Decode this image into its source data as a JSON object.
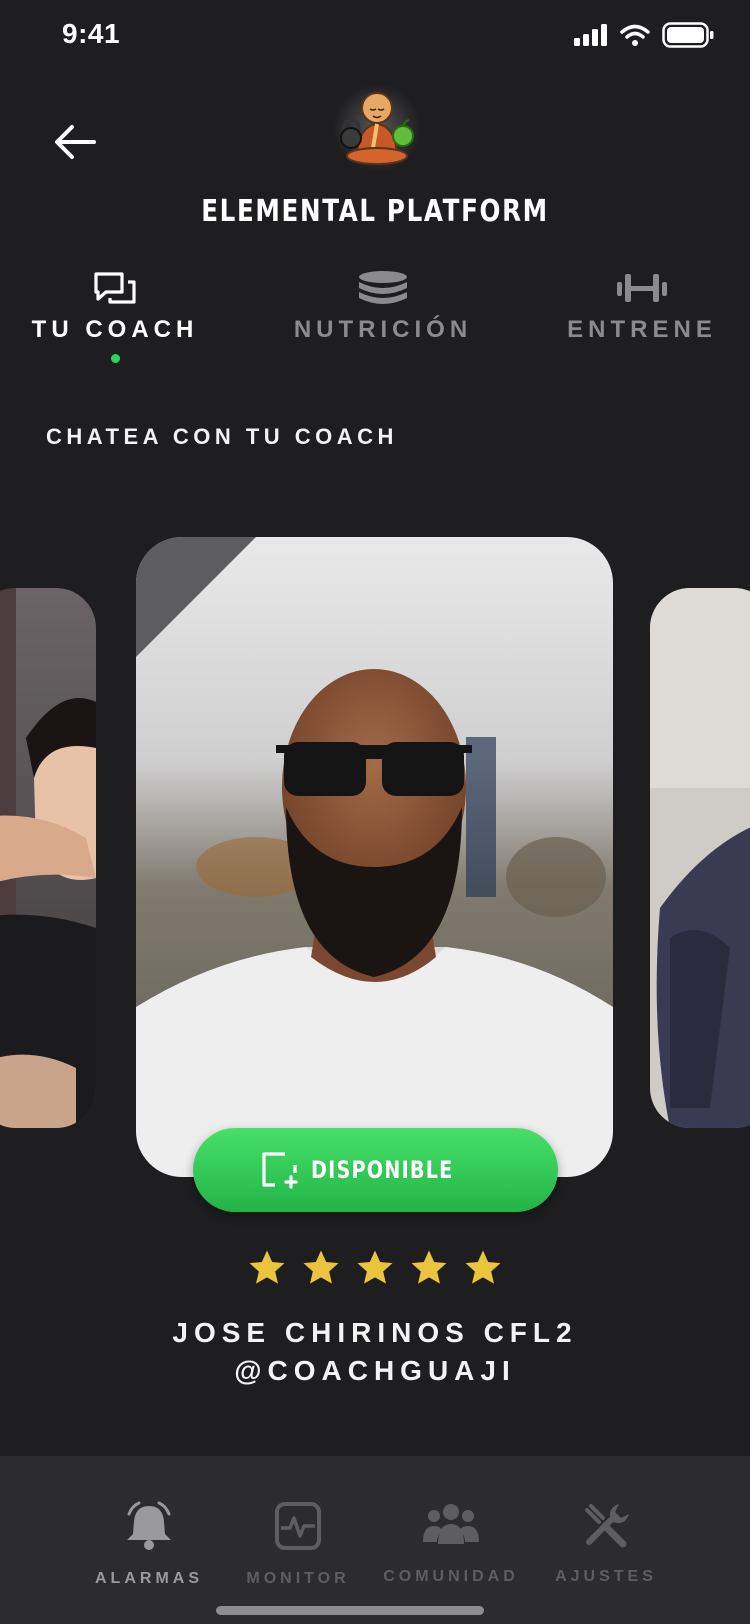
{
  "status_bar": {
    "time": "9:41"
  },
  "header": {
    "app_title": "ELEMENTAL PLATFORM"
  },
  "tabs": [
    {
      "label": "TU COACH",
      "icon": "chat-icon",
      "active": true
    },
    {
      "label": "NUTRICIÓN",
      "icon": "database-stack-icon",
      "active": false
    },
    {
      "label": "ENTRENE",
      "icon": "dumbbell-icon",
      "active": false
    }
  ],
  "section": {
    "title": "CHATEA CON TU COACH"
  },
  "featured_coach": {
    "availability_label": "DISPONIBLE",
    "rating": 5,
    "name": "JOSE CHIRINOS CFL2",
    "handle": "@COACHGUAJI"
  },
  "bottom_nav": [
    {
      "label": "ALARMAS",
      "icon": "bell-icon",
      "active": true
    },
    {
      "label": "MONITOR",
      "icon": "monitor-pulse-icon",
      "active": false
    },
    {
      "label": "COMUNIDAD",
      "icon": "group-icon",
      "active": false
    },
    {
      "label": "AJUSTES",
      "icon": "tools-icon",
      "active": false
    }
  ],
  "colors": {
    "background": "#1e1e20",
    "accent_green": "#2fd45a",
    "star_yellow": "#e9c43c",
    "nav_background": "#2c2c2e"
  }
}
